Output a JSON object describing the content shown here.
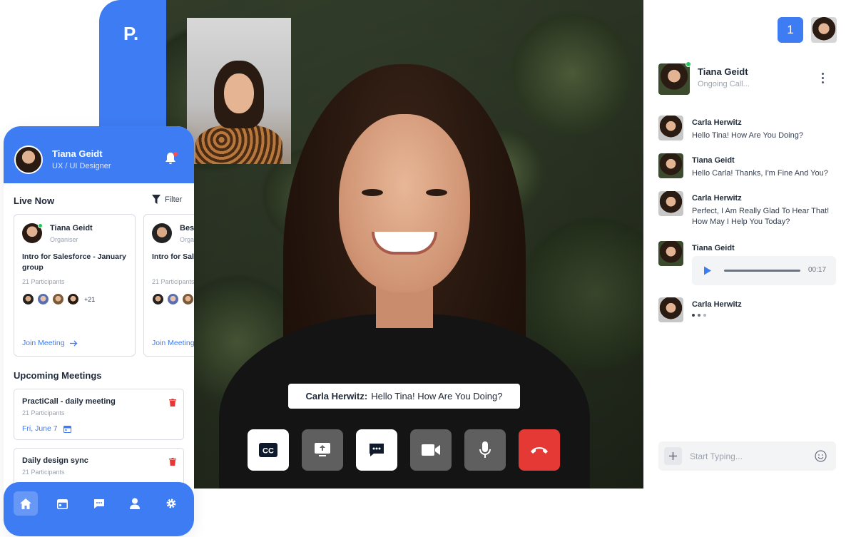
{
  "brand": {
    "logo": "P."
  },
  "mobile": {
    "user": {
      "name": "Tiana Geidt",
      "role": "UX / UI Designer"
    },
    "live": {
      "title": "Live Now",
      "filter_label": "Filter",
      "cards": [
        {
          "host": "Tiana Geidt",
          "host_role": "Organiser",
          "title": "Intro for Salesforce - January group",
          "participants": "21 Participants",
          "more": "+21",
          "join": "Join Meeting"
        },
        {
          "host": "Bess",
          "host_role": "Orga",
          "title": "Intro for Sale groupIntro f",
          "participants": "21 Participants",
          "join": "Join Meeting"
        }
      ]
    },
    "upcoming": {
      "title": "Upcoming Meetings",
      "items": [
        {
          "name": "PractiCall - daily meeting",
          "participants": "21 Participants",
          "date": "Fri, June 7"
        },
        {
          "name": "Daily design sync",
          "participants": "21 Participants"
        }
      ]
    }
  },
  "video": {
    "caption": {
      "speaker": "Carla Herwitz:",
      "text": "Hello Tina! How Are You Doing?"
    },
    "controls": [
      {
        "icon": "closed-captions-icon",
        "style": "white"
      },
      {
        "icon": "share-screen-icon",
        "style": "gray"
      },
      {
        "icon": "chat-icon",
        "style": "white"
      },
      {
        "icon": "camera-icon",
        "style": "gray"
      },
      {
        "icon": "microphone-icon",
        "style": "gray"
      },
      {
        "icon": "end-call-icon",
        "style": "red"
      }
    ]
  },
  "chat": {
    "badge": "1",
    "call": {
      "name": "Tiana Geidt",
      "status": "Ongoing Call..."
    },
    "messages": [
      {
        "sender": "Carla Herwitz",
        "text": "Hello Tina! How Are You Doing?"
      },
      {
        "sender": "Tiana Geidt",
        "text": "Hello Carla! Thanks, I'm Fine And You?"
      },
      {
        "sender": "Carla Herwitz",
        "text": "Perfect, I Am Really Glad To Hear That! How May I Help You Today?"
      },
      {
        "sender": "Tiana Geidt",
        "audio_duration": "00:17"
      },
      {
        "sender": "Carla Herwitz",
        "typing": true
      }
    ],
    "composer": {
      "placeholder": "Start Typing..."
    }
  },
  "colors": {
    "primary": "#3D7CF2",
    "danger": "#E53935",
    "online": "#22C55E"
  }
}
